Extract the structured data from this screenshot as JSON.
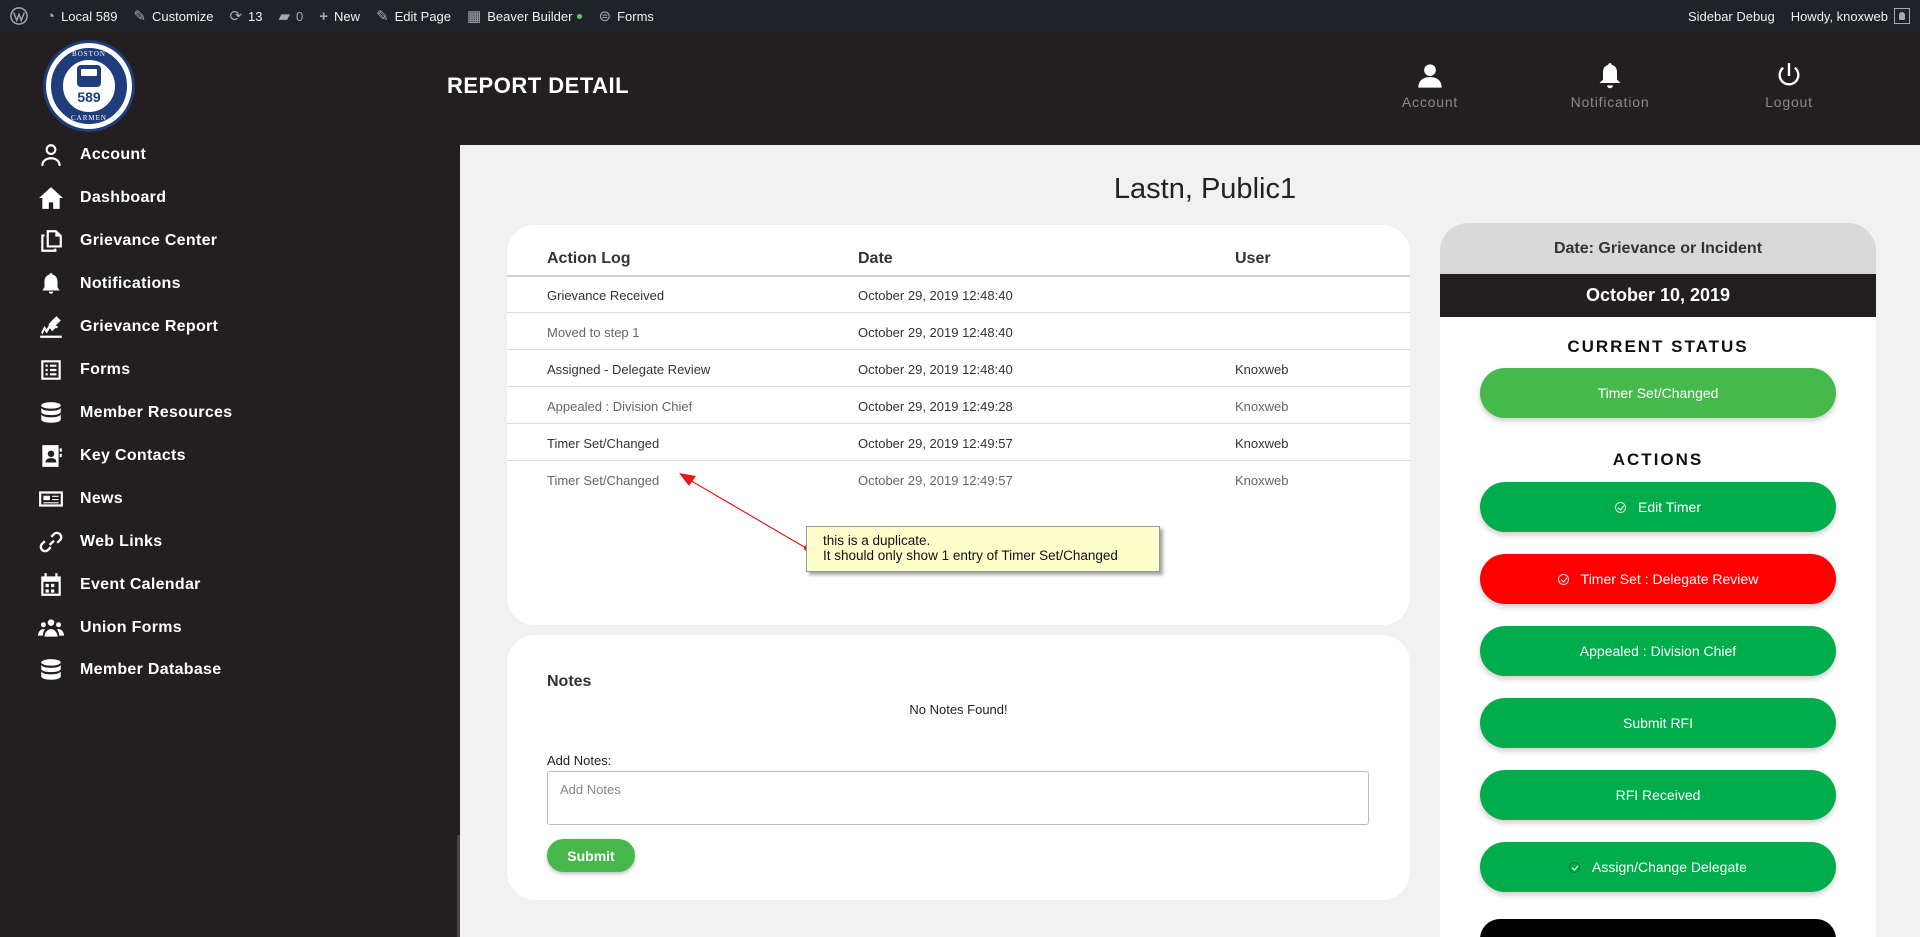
{
  "adminbar": {
    "site": "Local 589",
    "customize": "Customize",
    "updates": "13",
    "comments": "0",
    "new": "New",
    "edit_page": "Edit Page",
    "beaver": "Beaver Builder",
    "forms": "Forms",
    "sidebar_debug": "Sidebar Debug",
    "howdy": "Howdy, knoxweb"
  },
  "logo": {
    "top_text": "BOSTON",
    "number": "589",
    "bottom_text": "CARMEN"
  },
  "sidebar": {
    "items": [
      {
        "label": "Account",
        "icon": "user-icon"
      },
      {
        "label": "Dashboard",
        "icon": "home-icon"
      },
      {
        "label": "Grievance Center",
        "icon": "copy-icon"
      },
      {
        "label": "Notifications",
        "icon": "bell-icon"
      },
      {
        "label": "Grievance Report",
        "icon": "signature-icon"
      },
      {
        "label": "Forms",
        "icon": "form-icon"
      },
      {
        "label": "Member Resources",
        "icon": "database-icon"
      },
      {
        "label": "Key Contacts",
        "icon": "contact-icon"
      },
      {
        "label": "News",
        "icon": "newspaper-icon"
      },
      {
        "label": "Web Links",
        "icon": "link-icon"
      },
      {
        "label": "Event Calendar",
        "icon": "calendar-icon"
      },
      {
        "label": "Union Forms",
        "icon": "users-icon"
      },
      {
        "label": "Member Database",
        "icon": "database-icon"
      }
    ]
  },
  "header": {
    "title": "REPORT DETAIL",
    "account": "Account",
    "notification": "Notification",
    "logout": "Logout"
  },
  "member_name": "Lastn, Public1",
  "action_log": {
    "headers": [
      "Action Log",
      "Date",
      "User"
    ],
    "rows": [
      [
        "Grievance Received",
        "October 29, 2019 12:48:40",
        ""
      ],
      [
        "Moved to step 1",
        "October 29, 2019 12:48:40",
        ""
      ],
      [
        "Assigned - Delegate Review",
        "October 29, 2019 12:48:40",
        "Knoxweb"
      ],
      [
        "Appealed : Division Chief",
        "October 29, 2019 12:49:28",
        "Knoxweb"
      ],
      [
        "Timer Set/Changed",
        "October 29, 2019 12:49:57",
        "Knoxweb"
      ],
      [
        "Timer Set/Changed",
        "October 29, 2019 12:49:57",
        "Knoxweb"
      ]
    ]
  },
  "annotation": {
    "line1": "this is a duplicate.",
    "line2": "It should only show 1 entry of Timer Set/Changed"
  },
  "notes": {
    "title": "Notes",
    "empty": "No Notes Found!",
    "add_label": "Add Notes:",
    "placeholder": "Add Notes",
    "submit": "Submit"
  },
  "status_panel": {
    "date_heading": "Date: Grievance or Incident",
    "date_value": "October 10, 2019",
    "current_status_title": "CURRENT STATUS",
    "current_status": "Timer Set/Changed",
    "actions_title": "ACTIONS",
    "actions": [
      {
        "label": "Edit Timer",
        "icon": "check-circle-icon"
      },
      {
        "label": "Timer Set : Delegate Review",
        "icon": "check-circle-icon"
      },
      {
        "label": "Appealed : Division Chief",
        "icon": ""
      },
      {
        "label": "Submit RFI",
        "icon": ""
      },
      {
        "label": "RFI Received",
        "icon": ""
      },
      {
        "label": "Assign/Change Delegate",
        "icon": "circle-icon"
      }
    ]
  },
  "colors": {
    "green": "#00ad4a",
    "light_green": "#46b94d",
    "red": "#ff0000",
    "dark": "#231f20"
  }
}
